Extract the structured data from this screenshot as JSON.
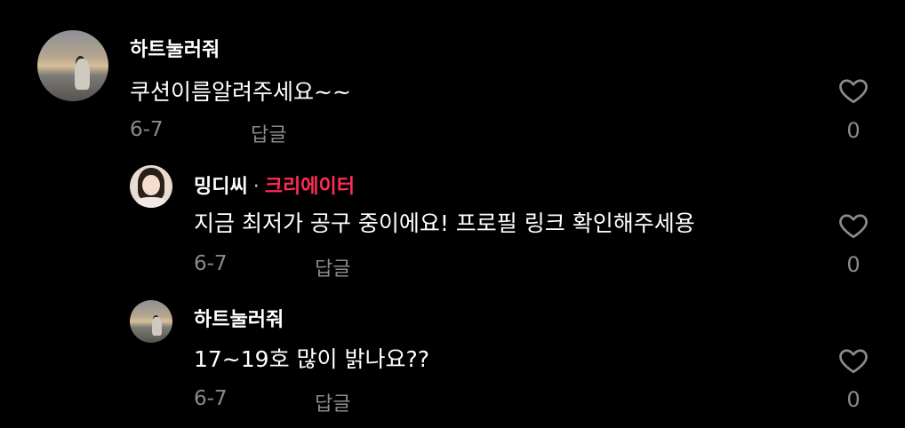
{
  "comments": [
    {
      "user": "하트눌러줘",
      "text": "쿠션이름알려주세요~~",
      "date": "6-7",
      "reply_label": "답글",
      "likes": "0",
      "avatar_icon": "beach-photo-avatar"
    },
    {
      "user": "밍디씨",
      "separator": "·",
      "badge": "크리에이터",
      "text": "지금 최저가 공구 중이에요! 프로필 링크 확인해주세용",
      "date": "6-7",
      "reply_label": "답글",
      "likes": "0",
      "avatar_icon": "portrait-avatar",
      "badge_color": "#fe2c55"
    },
    {
      "user": "하트눌러줘",
      "text": "17~19호 많이 밝나요??",
      "date": "6-7",
      "reply_label": "답글",
      "likes": "0",
      "avatar_icon": "beach-photo-avatar"
    }
  ],
  "icons": {
    "like": "heart-outline-icon"
  }
}
